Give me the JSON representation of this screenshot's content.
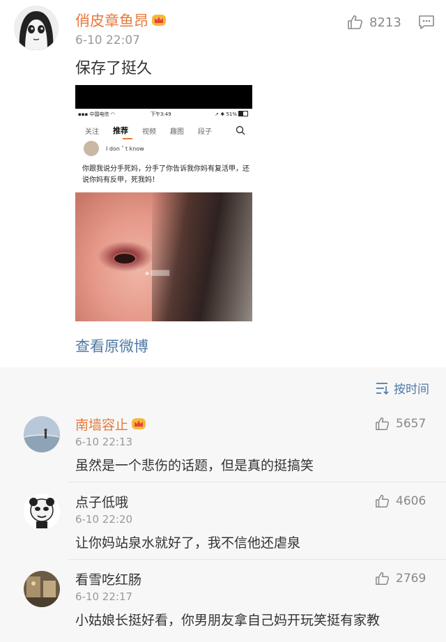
{
  "post": {
    "author": "俏皮章鱼昂",
    "time": "6-10 22:07",
    "likes": "8213",
    "text": "保存了挺久",
    "view_original": "查看原微博"
  },
  "embedded_screenshot": {
    "status_carrier": "中国电信",
    "status_time": "下午3:49",
    "status_battery": "51%",
    "tabs": [
      "关注",
      "推荐",
      "视频",
      "趣图",
      "段子"
    ],
    "active_tab": "推荐",
    "user": "I don＇t know",
    "text": "你跟我说分手死妈，分手了你告诉我你妈有复活甲，还说你妈有反甲，死我妈！"
  },
  "sort_label": "按时间",
  "comments": [
    {
      "name": "南墙容止",
      "vip": true,
      "time": "6-10 22:13",
      "likes": "5657",
      "text": "虽然是一个悲伤的话题，但是真的挺搞笑"
    },
    {
      "name": "点子低哦",
      "vip": false,
      "time": "6-10 22:20",
      "likes": "4606",
      "text": "让你妈站泉水就好了，我不信他还虐泉"
    },
    {
      "name": "看雪吃红肠",
      "vip": false,
      "time": "6-10 22:17",
      "likes": "2769",
      "text": "小姑娘长挺好看，你男朋友拿自己妈开玩笑挺有家教"
    }
  ],
  "colors": {
    "accent": "#e8793a",
    "link": "#4e79a7",
    "muted": "#999999"
  }
}
